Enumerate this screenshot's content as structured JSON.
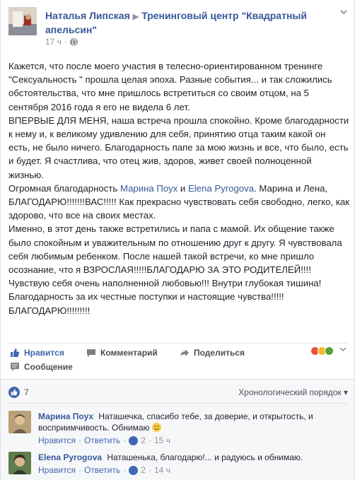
{
  "header": {
    "author": "Наталья Липская",
    "separator": "▶",
    "group": "Тренинговый центр \"Квадратный апельсин\"",
    "time": "17 ч",
    "dot": "·"
  },
  "post": {
    "p1": "Кажется, что после моего участия в телесно-ориентированном тренинге \"Сексуальность \" прошла целая эпоха. Разные события... и так сложились обстоятельства, что мне пришлось встретиться со своим отцом, на 5 сентября 2016 года я его не видела 6 лет.",
    "p2": "ВПЕРВЫЕ ДЛЯ МЕНЯ, наша встреча прошла спокойно. Кроме благодарности к нему и, к великому удивлению для себя, принятию отца таким какой он есть, не было ничего. Благодарность папе за мою жизнь и все, что было, есть и будет. Я счастлива, что отец жив, здоров, живет своей полноценной жизнью.",
    "p3_a": "Огромная благодарность ",
    "mention1": "Марина Поух",
    "p3_b": " и ",
    "mention2": "Elena Pyrogova",
    "p3_c": ". Марина и Лена, БЛАГОДАРЮ!!!!!!!ВАС!!!!! Как прекрасно чувствовать себя свободно, легко, как здорово, что все на своих местах.",
    "p4": "Именно, в этот день также встретились и папа с мамой. Их общение также было спокойным и уважительным по отношению друг к другу. Я чувствовала себя любимым ребенком. После нашей такой встречи, ко мне пришло осознание, что я ВЗРОСЛАЯ!!!!!БЛАГОДАРЮ ЗА ЭТО РОДИТЕЛЕЙ!!!! Чувствую себя очень наполненной любовью!!! Внутри глубокая тишина! Благодарность за их честные поступки и настоящие чувства!!!!!",
    "p5": "БЛАГОДАРЮ!!!!!!!!!"
  },
  "actions": {
    "like": "Нравится",
    "comment": "Комментарий",
    "share": "Поделиться",
    "message": "Сообщение"
  },
  "comments": {
    "like_count": "7",
    "order": "Хронологический порядок",
    "order_caret": "▾",
    "items": [
      {
        "name": "Марина Поух",
        "text": "Наташечка, спасибо тебе, за доверие, и открытость, и восприимчивость. Обнимаю",
        "like_label": "Нравится",
        "reply_label": "Ответить",
        "likes": "2",
        "time": "15 ч"
      },
      {
        "name": "Elena Pyrogova",
        "text": "Наташенька, благодарю!... и радуюсь и обнимаю.",
        "like_label": "Нравится",
        "reply_label": "Ответить",
        "likes": "2",
        "time": "14 ч"
      }
    ]
  },
  "colors": {
    "link": "#365899",
    "like_blue": "#4267b2",
    "meta_gray": "#90949c",
    "comments_bg": "#f6f7f9"
  }
}
